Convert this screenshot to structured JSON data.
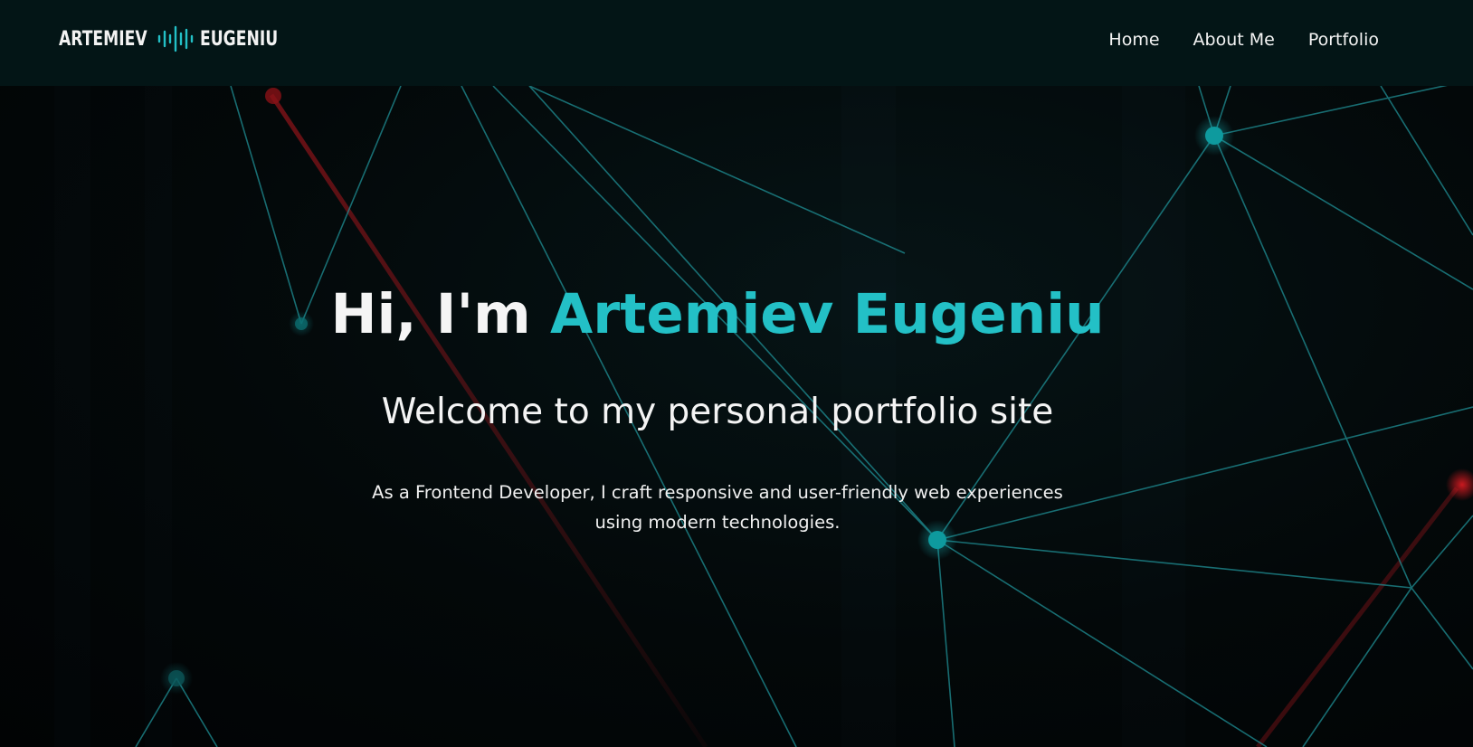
{
  "logo": {
    "first_word": "ARTEMIEV",
    "second_word": "EUGENIU",
    "icon": "soundwave-icon"
  },
  "nav": {
    "items": [
      {
        "label": "Home"
      },
      {
        "label": "About Me"
      },
      {
        "label": "Portfolio"
      }
    ]
  },
  "hero": {
    "greeting": "Hi, I'm ",
    "name": "Artemiev Eugeniu",
    "subtitle": "Welcome to my personal portfolio site",
    "description": "As a Frontend Developer, I craft responsive and user-friendly web experiences using modern technologies."
  },
  "colors": {
    "accent": "#23c0c6",
    "navbar_bg": "#031516",
    "page_bg": "#020607",
    "text": "#f5f5f5",
    "network_line": "#1f8f95",
    "network_node": "#0e9a9e",
    "red_glow": "#a0141a"
  }
}
